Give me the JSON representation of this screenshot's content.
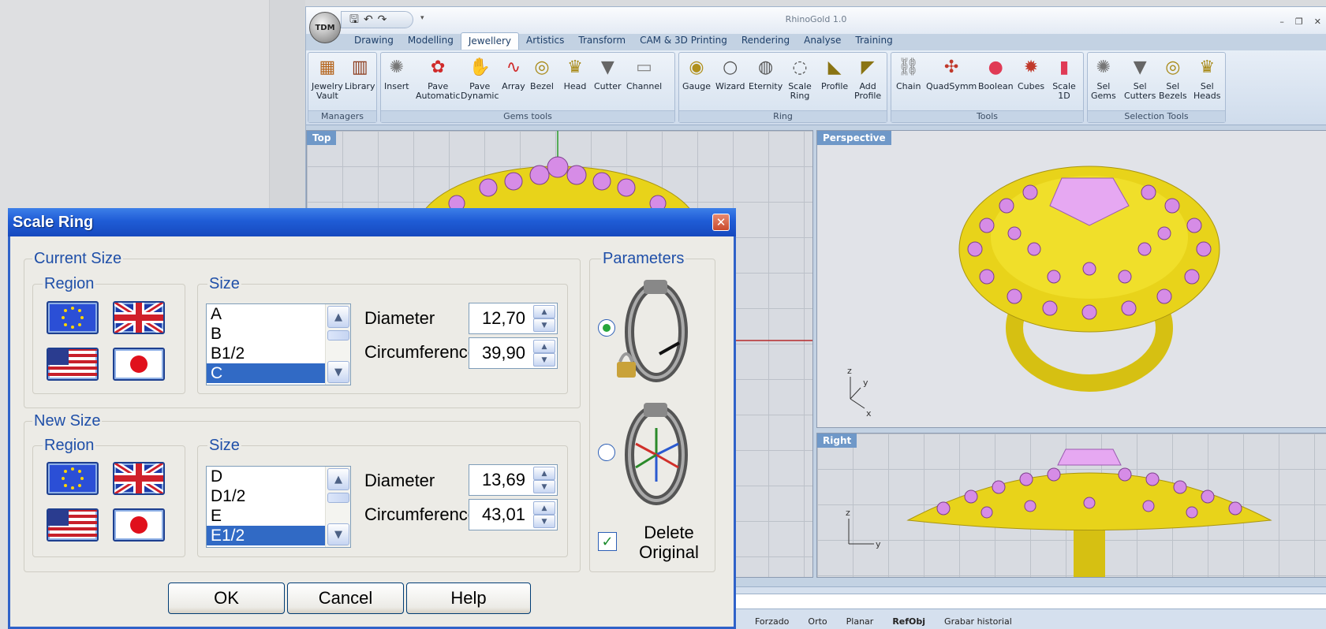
{
  "app": {
    "title": "RhinoGold 1.0",
    "logo_text": "TDM",
    "window_controls": [
      "–",
      "❐",
      "✕"
    ],
    "ribbon_tabs": [
      "Drawing",
      "Modelling",
      "Jewellery",
      "Artistics",
      "Transform",
      "CAM & 3D Printing",
      "Rendering",
      "Analyse",
      "Training"
    ],
    "active_tab": "Jewellery",
    "groups": {
      "managers": {
        "label": "Managers",
        "buttons": [
          "Jewelry\nVault",
          "Library"
        ]
      },
      "gems": {
        "label": "Gems tools",
        "buttons": [
          "Insert",
          "Pave\nAutomatic",
          "Pave\nDynamic",
          "Array",
          "Bezel",
          "Head",
          "Cutter",
          "Channel"
        ]
      },
      "ring": {
        "label": "Ring",
        "buttons": [
          "Gauge",
          "Wizard",
          "Eternity",
          "Scale\nRing",
          "Profile",
          "Add\nProfile"
        ]
      },
      "tools": {
        "label": "Tools",
        "buttons": [
          "Chain",
          "QuadSymm",
          "Boolean",
          "Cubes",
          "Scale\n1D"
        ]
      },
      "selection": {
        "label": "Selection Tools",
        "buttons": [
          "Sel\nGems",
          "Sel\nCutters",
          "Sel\nBezels",
          "Sel\nHeads"
        ]
      }
    },
    "viewports": {
      "top": "Top",
      "perspective": "Perspective",
      "right": "Right"
    },
    "status_items": [
      "Forzado",
      "Orto",
      "Planar",
      "RefObj",
      "Grabar historial"
    ]
  },
  "dialog": {
    "title": "Scale Ring",
    "current_size": {
      "legend": "Current Size",
      "region_legend": "Region",
      "size_legend": "Size",
      "list": [
        "A",
        "B",
        "B1/2",
        "C"
      ],
      "selected": "C",
      "diameter_label": "Diameter",
      "diameter": "12,70",
      "circumference_label": "Circumference",
      "circumference": "39,90"
    },
    "new_size": {
      "legend": "New Size",
      "region_legend": "Region",
      "size_legend": "Size",
      "list": [
        "D",
        "D1/2",
        "E",
        "E1/2"
      ],
      "selected": "E1/2",
      "diameter_label": "Diameter",
      "diameter": "13,69",
      "circumference_label": "Circumference",
      "circumference": "43,01"
    },
    "parameters": {
      "legend": "Parameters",
      "option1_selected": true,
      "delete_original_label": "Delete\nOriginal",
      "delete_original_checked": true
    },
    "buttons": {
      "ok": "OK",
      "cancel": "Cancel",
      "help": "Help"
    }
  },
  "colors": {
    "dialog_title": "#1f5cd6",
    "legend_text": "#1f4fa8",
    "selection": "#316ac5",
    "gold": "#e8d31a",
    "gem": "#d68ce6"
  }
}
